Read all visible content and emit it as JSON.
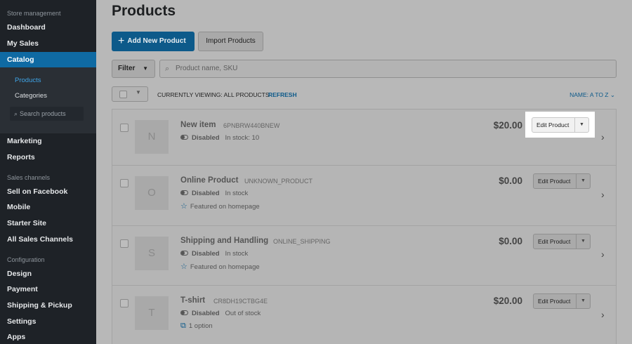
{
  "sidebar": {
    "store_heading": "Store management",
    "items": {
      "dashboard": "Dashboard",
      "my_sales": "My Sales",
      "catalog": "Catalog",
      "marketing": "Marketing",
      "reports": "Reports",
      "sell_on_facebook": "Sell on Facebook",
      "mobile": "Mobile",
      "starter_site": "Starter Site",
      "all_sales_channels": "All Sales Channels",
      "design": "Design",
      "payment": "Payment",
      "shipping_pickup": "Shipping & Pickup",
      "settings": "Settings",
      "apps": "Apps"
    },
    "catalog_sub": {
      "products": "Products",
      "categories": "Categories",
      "search_placeholder": "Search products"
    },
    "sales_channels_heading": "Sales channels",
    "configuration_heading": "Configuration"
  },
  "main": {
    "title": "Products",
    "add_button": "Add New Product",
    "import_button": "Import Products",
    "filter_label": "Filter",
    "search_placeholder": "Product name, SKU",
    "viewing_text": "CURRENTLY VIEWING: ALL PRODUCTS",
    "refresh_label": "REFRESH",
    "sort_label": "NAME: A TO Z"
  },
  "products": [
    {
      "initial": "N",
      "name": "New item",
      "sku": "6PNBRW440BNEW",
      "status": "Disabled",
      "stock": "In stock: 10",
      "extra": "",
      "price": "$20.00",
      "edit_label": "Edit Product"
    },
    {
      "initial": "O",
      "name": "Online Product",
      "sku": "UNKNOWN_PRODUCT",
      "status": "Disabled",
      "stock": "In stock",
      "extra": "Featured on homepage",
      "price": "$0.00",
      "edit_label": "Edit Product"
    },
    {
      "initial": "S",
      "name": "Shipping and Handling",
      "sku": "ONLINE_SHIPPING",
      "status": "Disabled",
      "stock": "In stock",
      "extra": "Featured on homepage",
      "price": "$0.00",
      "edit_label": "Edit Product"
    },
    {
      "initial": "T",
      "name": "T-shirt",
      "sku": "CR8DH19CTBG4E",
      "status": "Disabled",
      "stock": "Out of stock",
      "extra": "1 option",
      "price": "$20.00",
      "edit_label": "Edit Product"
    }
  ],
  "colors": {
    "accent": "#0f6aa3",
    "sidebar_bg": "#1e2227"
  }
}
